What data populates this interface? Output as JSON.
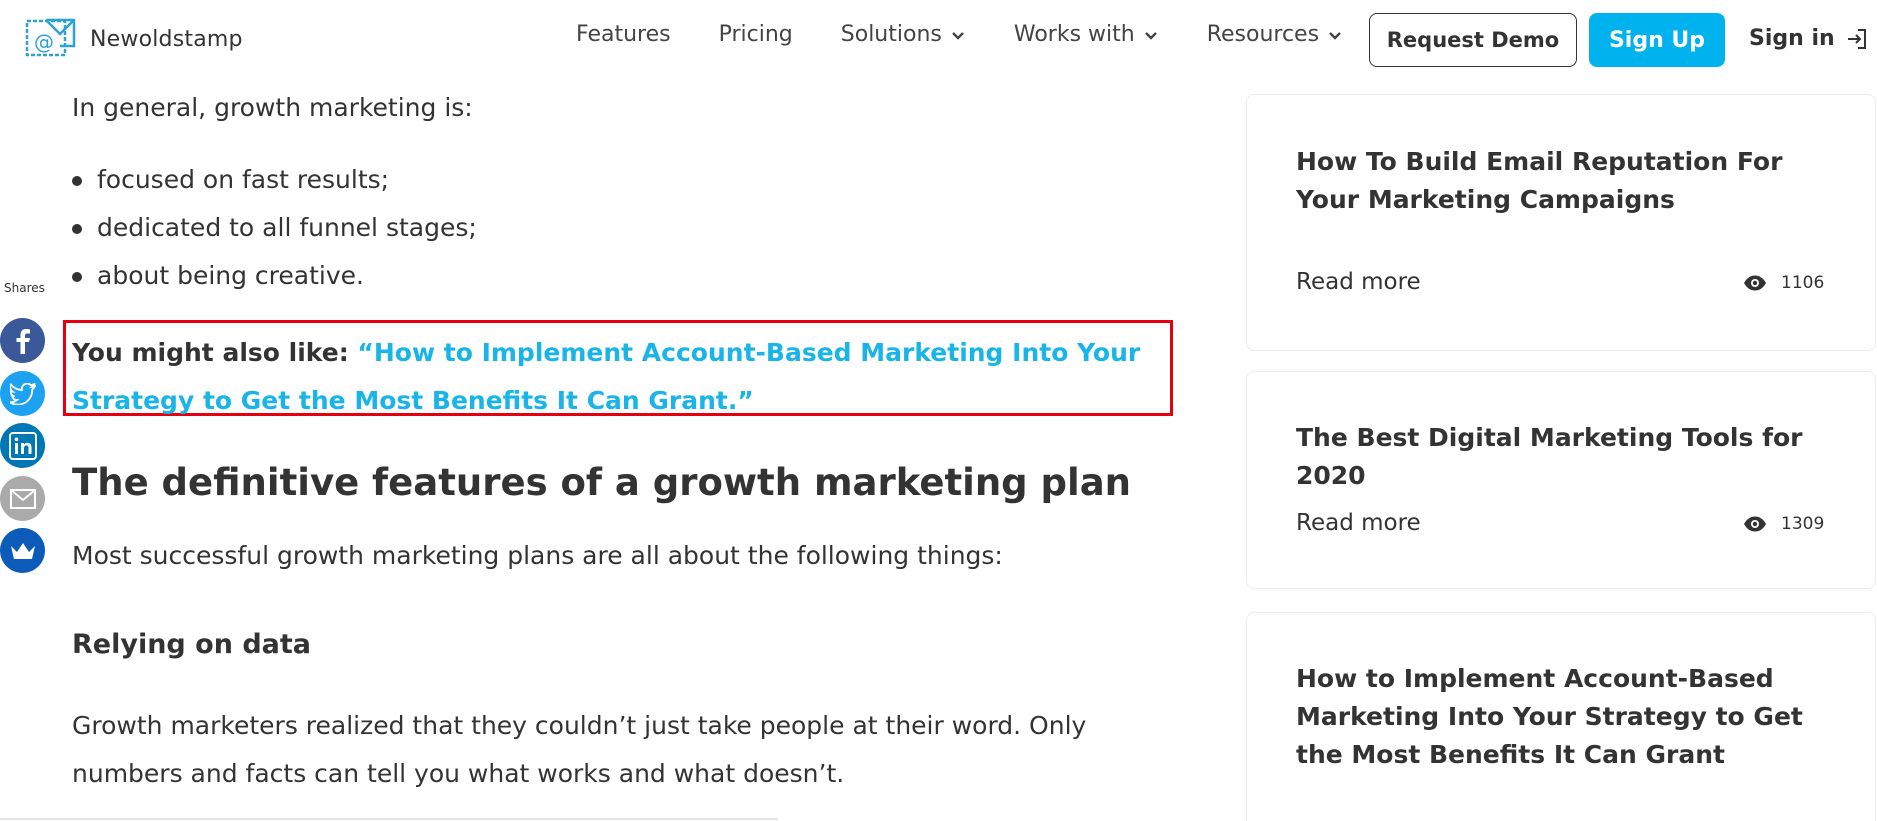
{
  "header": {
    "logo_text": "Newoldstamp",
    "nav": [
      {
        "label": "Features",
        "has_dropdown": false
      },
      {
        "label": "Pricing",
        "has_dropdown": false
      },
      {
        "label": "Solutions",
        "has_dropdown": true
      },
      {
        "label": "Works with",
        "has_dropdown": true
      },
      {
        "label": "Resources",
        "has_dropdown": true
      }
    ],
    "request_demo_label": "Request Demo",
    "sign_up_label": "Sign Up",
    "sign_in_label": "Sign in",
    "accent_color": "#00b2ee"
  },
  "article": {
    "intro": "In general, growth marketing is:",
    "bullets": [
      "focused on fast results;",
      "dedicated to all funnel stages;",
      "about being creative."
    ],
    "also_like_label": "You might also like:",
    "also_like_link": "“How to Implement Account-Based Marketing Into Your Strategy to Get the Most Benefits It Can Grant.”",
    "heading": "The definitive features of a growth marketing plan",
    "paragraph": "Most successful growth marketing plans are all about the following things:",
    "subheading": "Relying on data",
    "paragraph2": "Growth marketers realized that they couldn’t just take people at their word. Only numbers and facts can tell you what works and what doesn’t."
  },
  "share": {
    "label": "Shares",
    "buttons": [
      "facebook-icon",
      "twitter-icon",
      "linkedin-icon",
      "email-icon",
      "crown-icon"
    ]
  },
  "sidebar": {
    "cards": [
      {
        "title": "How To Build Email Reputation For Your Marketing Campaigns",
        "read_more": "Read more",
        "views": "1106"
      },
      {
        "title": "The Best Digital Marketing Tools for 2020",
        "read_more": "Read more",
        "views": "1309"
      },
      {
        "title": "How to Implement Account-Based Marketing Into Your Strategy to Get the Most Benefits It Can Grant",
        "read_more": "",
        "views": ""
      }
    ]
  },
  "colors": {
    "link": "#19b4e8",
    "highlight_border": "#e5000f",
    "text": "#333333"
  }
}
